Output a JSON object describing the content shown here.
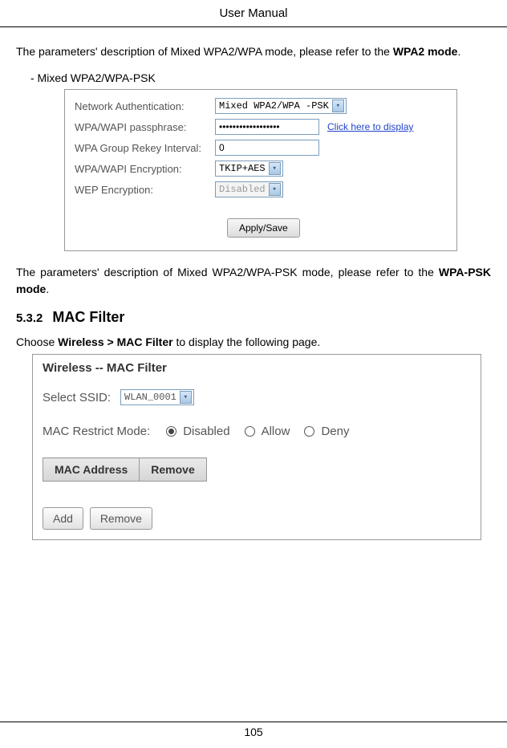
{
  "header": "User Manual",
  "para1_a": "The parameters' description of Mixed WPA2/WPA mode, please refer to the ",
  "para1_b": "WPA2 mode",
  "para1_c": ".",
  "bullet1": "-   Mixed WPA2/WPA-PSK",
  "form1": {
    "labels": {
      "netauth": "Network Authentication:",
      "passphrase": "WPA/WAPI passphrase:",
      "rekey": "WPA Group Rekey Interval:",
      "encryption": "WPA/WAPI Encryption:",
      "wep": "WEP Encryption:"
    },
    "values": {
      "netauth": "Mixed WPA2/WPA -PSK",
      "passphrase": "••••••••••••••••••",
      "rekey": "0",
      "encryption": "TKIP+AES",
      "wep": "Disabled"
    },
    "link": "Click here to display",
    "apply": "Apply/Save"
  },
  "para2_a": "The parameters' description of Mixed WPA2/WPA-PSK mode, please refer to the ",
  "para2_b": "WPA-PSK mode",
  "para2_c": ".",
  "section": {
    "num": "5.3.2",
    "title": "MAC Filter"
  },
  "para3_a": "Choose ",
  "para3_b": "Wireless > MAC Filter",
  "para3_c": " to display the following page.",
  "form2": {
    "title": "Wireless -- MAC Filter",
    "ssid_label": "Select SSID:",
    "ssid_value": "WLAN_0001",
    "restrict_label": "MAC Restrict Mode:",
    "radios": {
      "disabled": "Disabled",
      "allow": "Allow",
      "deny": "Deny"
    },
    "table": {
      "col1": "MAC Address",
      "col2": "Remove"
    },
    "btn_add": "Add",
    "btn_remove": "Remove"
  },
  "page_num": "105"
}
